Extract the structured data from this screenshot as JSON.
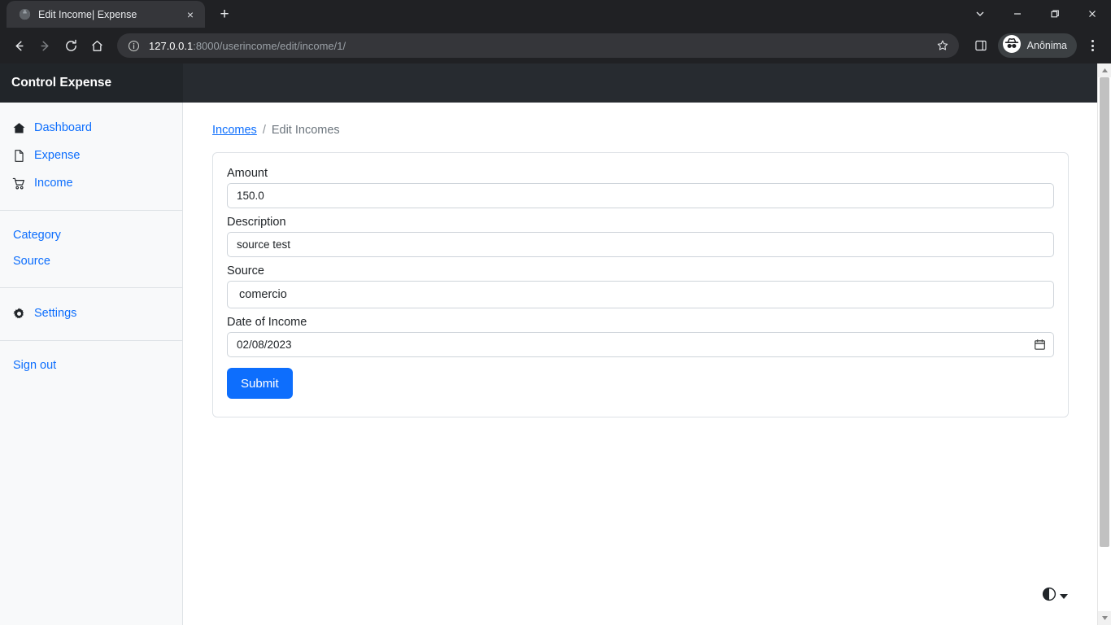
{
  "browser": {
    "tab": {
      "title": "Edit Income| Expense",
      "favicon": "globe-icon",
      "close": "×"
    },
    "newtab_label": "+",
    "window_controls": {
      "minimize": "—",
      "maximize": "❐",
      "close": "✕",
      "chevron": "⌄"
    },
    "nav": {
      "back": "←",
      "forward": "→",
      "reload": "↻",
      "home": "⌂"
    },
    "omnibox": {
      "host": "127.0.0.1",
      "path": ":8000/userincome/edit/income/1/",
      "info_icon": "info-icon",
      "star_icon": "star-icon"
    },
    "side_panel_icon": "side-panel-icon",
    "profile": {
      "label": "Anônima",
      "icon": "incognito-icon"
    },
    "menu_icon": "three-dots-icon"
  },
  "app": {
    "brand": "Control Expense"
  },
  "sidebar": {
    "groups": [
      {
        "items": [
          {
            "label": "Dashboard",
            "icon": "home-icon"
          },
          {
            "label": "Expense",
            "icon": "document-icon"
          },
          {
            "label": "Income",
            "icon": "cart-icon"
          }
        ]
      },
      {
        "items": [
          {
            "label": "Category",
            "icon": ""
          },
          {
            "label": "Source",
            "icon": ""
          }
        ]
      },
      {
        "items": [
          {
            "label": "Settings",
            "icon": "gear-icon"
          }
        ]
      },
      {
        "items": [
          {
            "label": "Sign out",
            "icon": ""
          }
        ]
      }
    ]
  },
  "breadcrumb": {
    "parent": "Incomes",
    "separator": "/",
    "current": "Edit Incomes"
  },
  "form": {
    "amount": {
      "label": "Amount",
      "value": "150.0"
    },
    "description": {
      "label": "Description",
      "value": "source test"
    },
    "source": {
      "label": "Source",
      "value": "comercio"
    },
    "date": {
      "label": "Date of Income",
      "value": "02/08/2023",
      "picker_icon": "calendar-icon"
    },
    "submit_label": "Submit"
  },
  "theme_toggle": {
    "icon": "contrast-circle-icon",
    "caret": "chevron-down-icon"
  },
  "colors": {
    "accent": "#0d6efd",
    "appbar": "#272b30",
    "brand_bg": "#212529",
    "sidebar_bg": "#f8f9fa",
    "border": "#dee2e6",
    "muted_text": "#6c757d"
  }
}
